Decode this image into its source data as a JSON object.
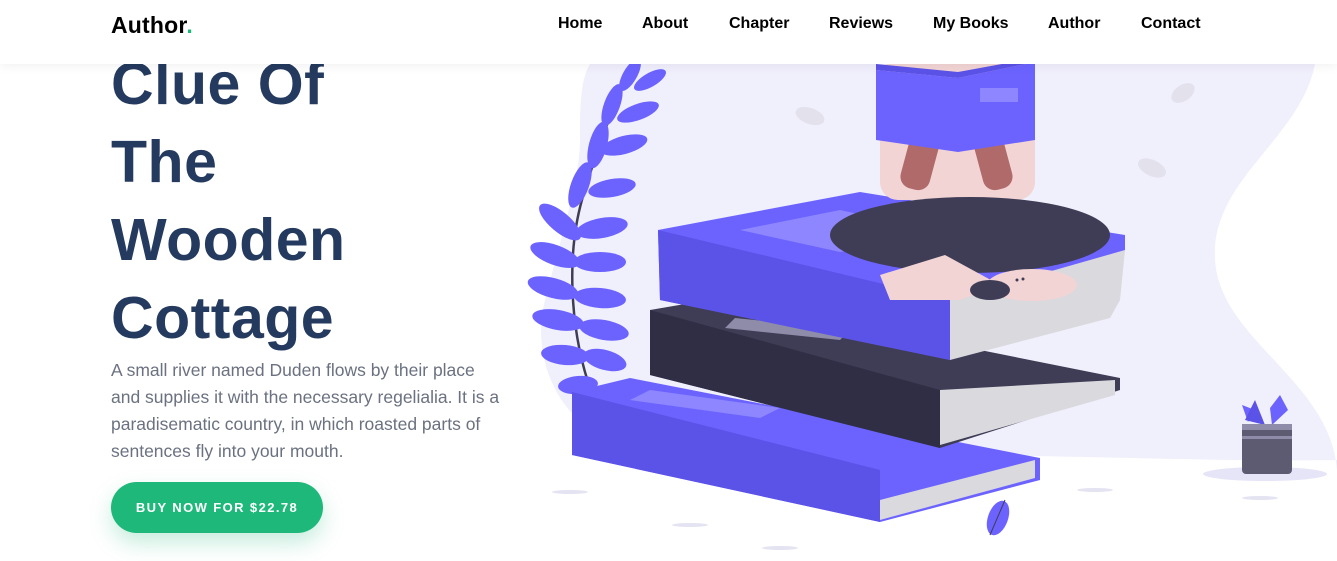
{
  "brand": {
    "name": "Author",
    "dot": "."
  },
  "nav": {
    "items": [
      {
        "label": "Home"
      },
      {
        "label": "About"
      },
      {
        "label": "Chapter"
      },
      {
        "label": "Reviews"
      },
      {
        "label": "My Books"
      },
      {
        "label": "Author"
      },
      {
        "label": "Contact"
      }
    ]
  },
  "hero": {
    "title_lines": [
      "Clue Of",
      "The",
      "Wooden",
      "Cottage"
    ],
    "description": "A small river named Duden flows by their place and supplies it with the necessary regelialia. It is a paradisematic country, in which roasted parts of sentences fly into your mouth.",
    "cta_label": "BUY NOW FOR $22.78"
  },
  "colors": {
    "accent": "#1eb97a",
    "title": "#243a5e",
    "text": "#6b7180",
    "book_primary": "#6c63ff",
    "book_dark": "#3f3d56",
    "blob": "#f0effc"
  },
  "icons": {
    "illustration": "person-reading-on-books-illustration",
    "plant": "fern-plant-icon",
    "pot": "potted-plant-icon",
    "leaf": "leaf-icon"
  }
}
